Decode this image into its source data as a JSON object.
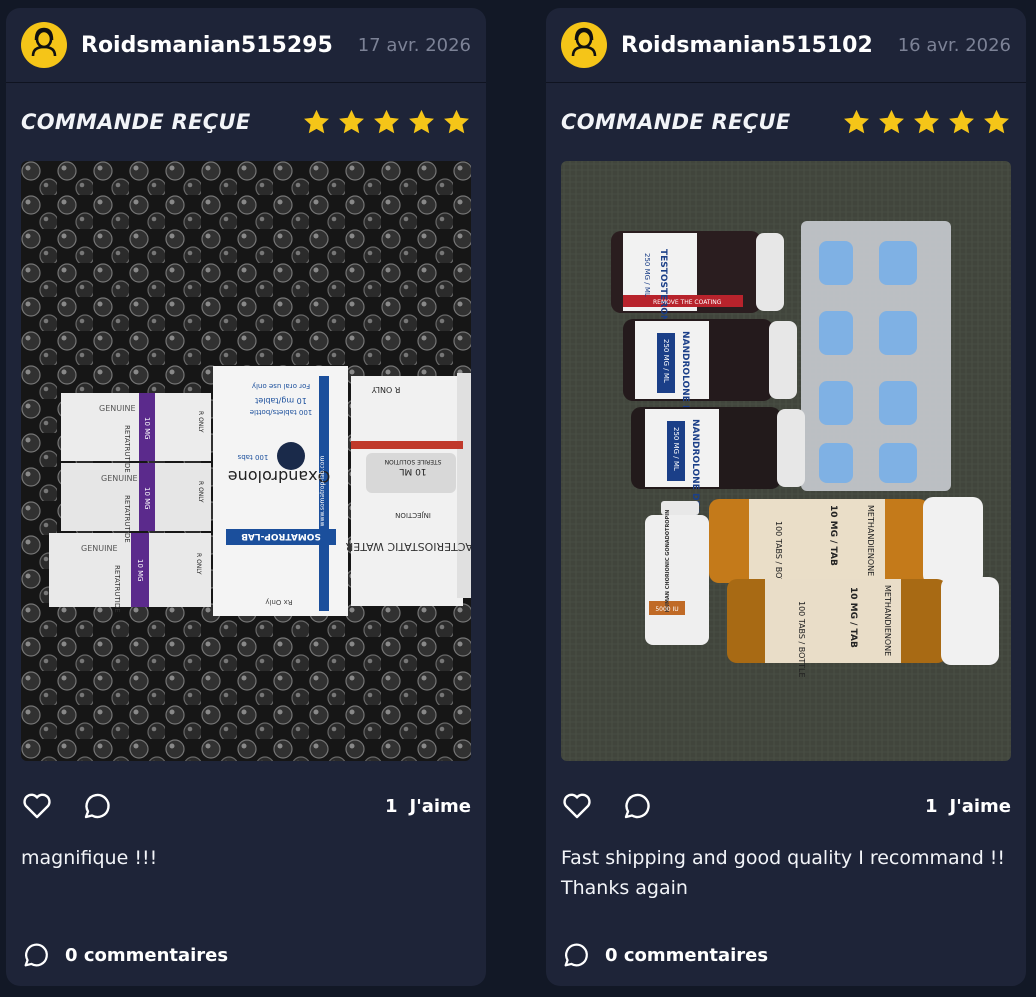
{
  "posts": [
    {
      "user": {
        "name": "Roidsmanian515295",
        "avatar_icon": "user-avatar-icon"
      },
      "date": "17 avr. 2026",
      "status_title": "COMMANDE REÇUE",
      "rating": 5,
      "likes": {
        "count": "1",
        "label": "J'aime"
      },
      "caption": "magnifique !!!",
      "comments": {
        "count": "0",
        "label": "commentaires"
      },
      "photo": {
        "labels": {
          "box1_name": "Oxandrolone",
          "box1_brand": "SOMATROP-LAB",
          "box1_dose": "10 mg/tablet",
          "box1_count": "100 tablets/bottle",
          "box1_oral": "For oral use only",
          "box1_url": "www.somatrop-lab.com",
          "box1_tabs": "100 tabs",
          "box1_rx": "Rx Only",
          "vial_dose": "10 MG",
          "vial_name": "RETATRUTIDE",
          "vial_genuine": "GENUINE",
          "vial_r": "R ONLY",
          "water_name": "BACTERIOSTATIC WATER",
          "water_inj": "INJECTION",
          "water_ml": "10 ML",
          "water_sterile": "STERILE SOLUTION",
          "water_r": "R ONLY"
        }
      }
    },
    {
      "user": {
        "name": "Roidsmanian515102",
        "avatar_icon": "user-avatar-icon"
      },
      "date": "16 avr. 2026",
      "status_title": "COMMANDE REÇUE",
      "rating": 5,
      "likes": {
        "count": "1",
        "label": "J'aime"
      },
      "caption": "Fast shipping and good quality I recommand !! Thanks again",
      "comments": {
        "count": "0",
        "label": "commentaires"
      },
      "photo": {
        "labels": {
          "b1_name": "TESTOSTERONE CYPIONATE",
          "b1_dose": "250 MG / ML",
          "b1_remove": "REMOVE THE COATING",
          "b2_name": "NANDROLONE DECANOATE",
          "b2_dose": "250 MG / ML",
          "b3_name": "NANDROLONE DECANOATE",
          "b3_dose": "250 MG / ML",
          "j1_name": "METHANDIENONE",
          "j1_dose": "10 MG / TAB",
          "j1_count": "100 TABS / BOTTLE",
          "j2_name": "METHANDIENONE",
          "j2_dose": "10 MG / TAB",
          "j2_count": "100 TABS / BOTTLE",
          "hcg_name": "HUMAN CHORIONIC GONADOTROPIN",
          "hcg_dose": "5000 IU"
        }
      }
    }
  ],
  "colors": {
    "background": "#121826",
    "card": "#1e2438",
    "star": "#f5c518",
    "avatar": "#f5c518",
    "muted_text": "#7c8296"
  }
}
